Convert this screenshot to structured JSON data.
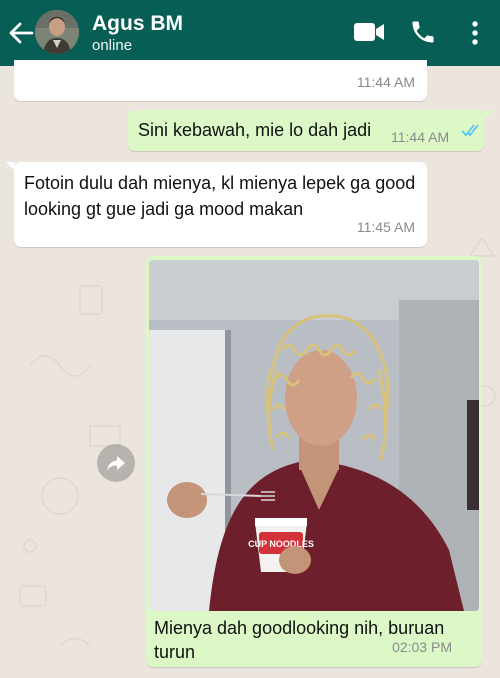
{
  "header": {
    "name": "Agus BM",
    "status": "online",
    "icons": [
      "back-arrow-icon",
      "avatar",
      "video-call-icon",
      "phone-icon",
      "more-vert-icon"
    ],
    "color": "#075e54"
  },
  "messages": [
    {
      "direction": "incoming",
      "text": "",
      "time": "11:44 AM"
    },
    {
      "direction": "outgoing",
      "text": "Sini kebawah, mie lo dah jadi",
      "time": "11:44 AM",
      "status": "read"
    },
    {
      "direction": "incoming",
      "text": "Fotoin dulu dah mienya, kl mienya lepek ga good looking gt gue jadi ga mood makan",
      "time": "11:45 AM"
    },
    {
      "direction": "outgoing",
      "type": "image",
      "caption": "Mienya dah goodlooking nih, buruan turun",
      "time": "02:03 PM",
      "image_text": "CUP NOODLES"
    }
  ],
  "colors": {
    "incoming_bubble": "#ffffff",
    "outgoing_bubble": "#dcf8c6",
    "chat_background": "#ece5dd",
    "read_ticks": "#4fc3f7"
  }
}
